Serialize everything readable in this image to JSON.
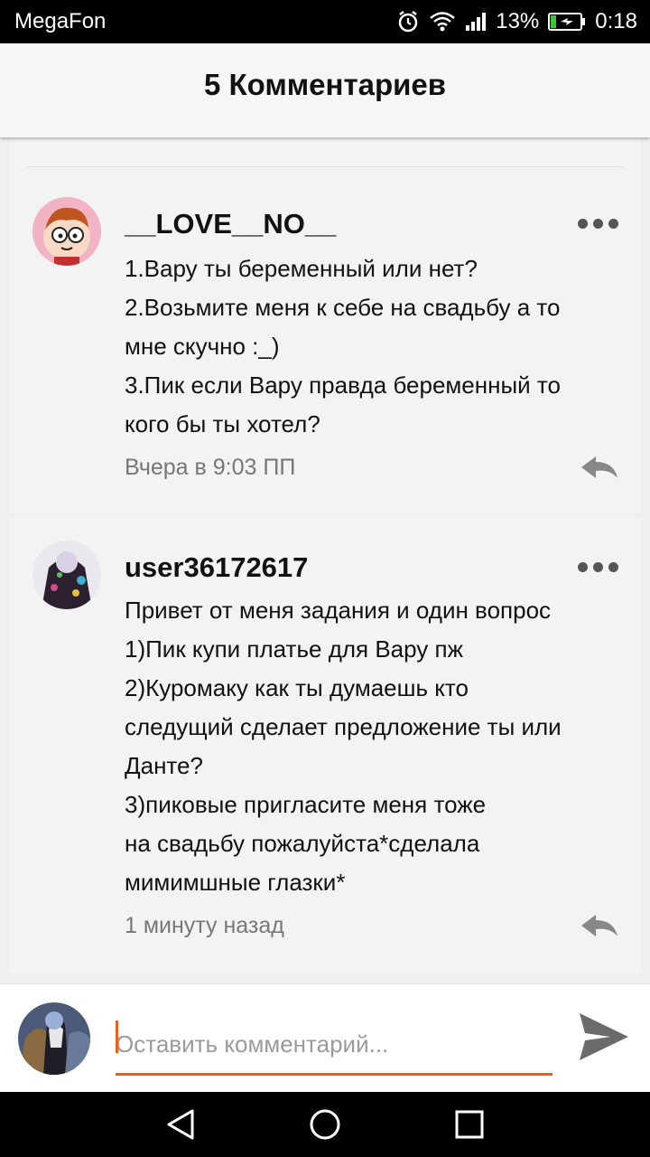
{
  "status_bar": {
    "carrier": "MegaFon",
    "battery": "13%",
    "time": "0:18",
    "icons": [
      "alarm-icon",
      "wifi-icon",
      "signal-icon",
      "battery-charging-icon"
    ]
  },
  "header": {
    "title": "5 Комментариев"
  },
  "comments": [
    {
      "author": "__LOVE__NO__",
      "lines": [
        "1.Вару ты беременный или нет?",
        "2.Возьмите меня к себе на свадьбу  а то",
        "мне скучно :_)",
        "3.Пик если Вару правда беременный то",
        "кого бы ты хотел?"
      ],
      "time": "Вчера в 9:03 ПП"
    },
    {
      "author": "user36172617",
      "lines": [
        "Привет от меня задания и один вопрос",
        "1)Пик купи платье для Вару пж",
        "2)Куромаку как ты думаешь кто",
        "следущий сделает предложение ты или",
        "Данте?",
        "3)пиковые пригласите меня тоже",
        "на свадьбу пожалуйста*сделала",
        "мимимшные глазки*"
      ],
      "time": "1 минуту назад"
    }
  ],
  "composer": {
    "placeholder": "Оставить комментарий...",
    "value": ""
  },
  "colors": {
    "accent": "#e8601c",
    "background": "#efefef",
    "card": "#f3f3f3"
  }
}
